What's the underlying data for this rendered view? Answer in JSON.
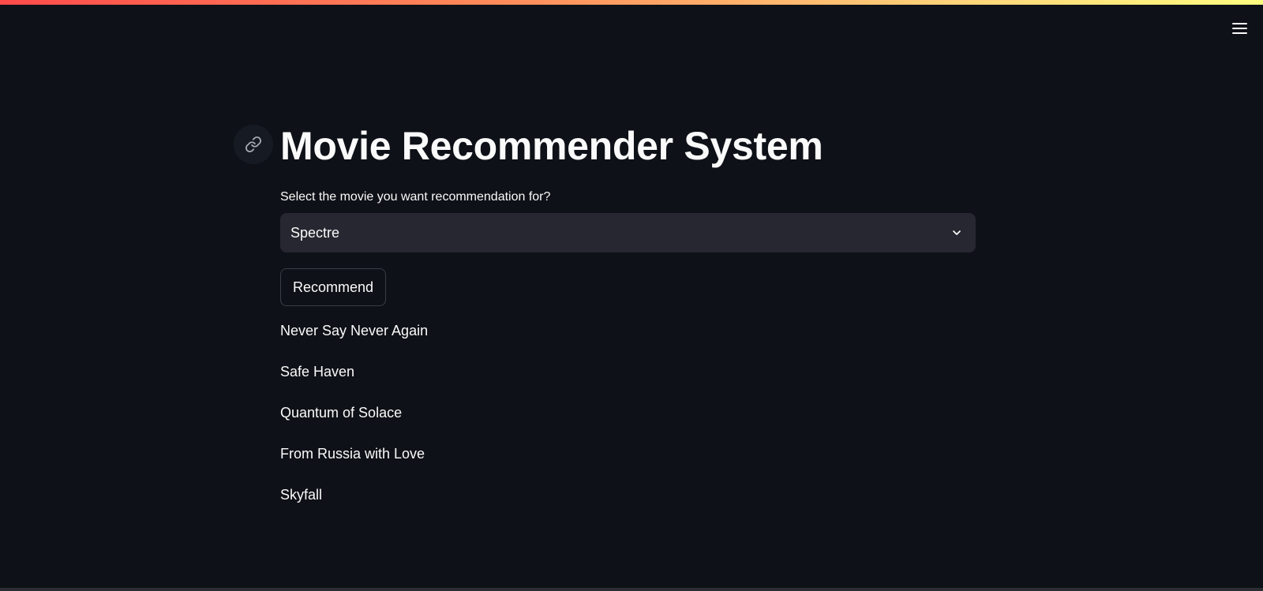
{
  "app": {
    "title": "Movie Recommender System",
    "accent_gradient": [
      "#ff4b4b",
      "#fffd80"
    ],
    "background": "#0e1117"
  },
  "header": {
    "menu_icon": "hamburger-menu-icon"
  },
  "title_anchor": {
    "icon": "link-icon"
  },
  "select": {
    "label": "Select the movie you want recommendation for?",
    "value": "Spectre",
    "icon": "chevron-down-icon"
  },
  "button": {
    "label": "Recommend"
  },
  "recommendations": [
    "Never Say Never Again",
    "Safe Haven",
    "Quantum of Solace",
    "From Russia with Love",
    "Skyfall"
  ]
}
